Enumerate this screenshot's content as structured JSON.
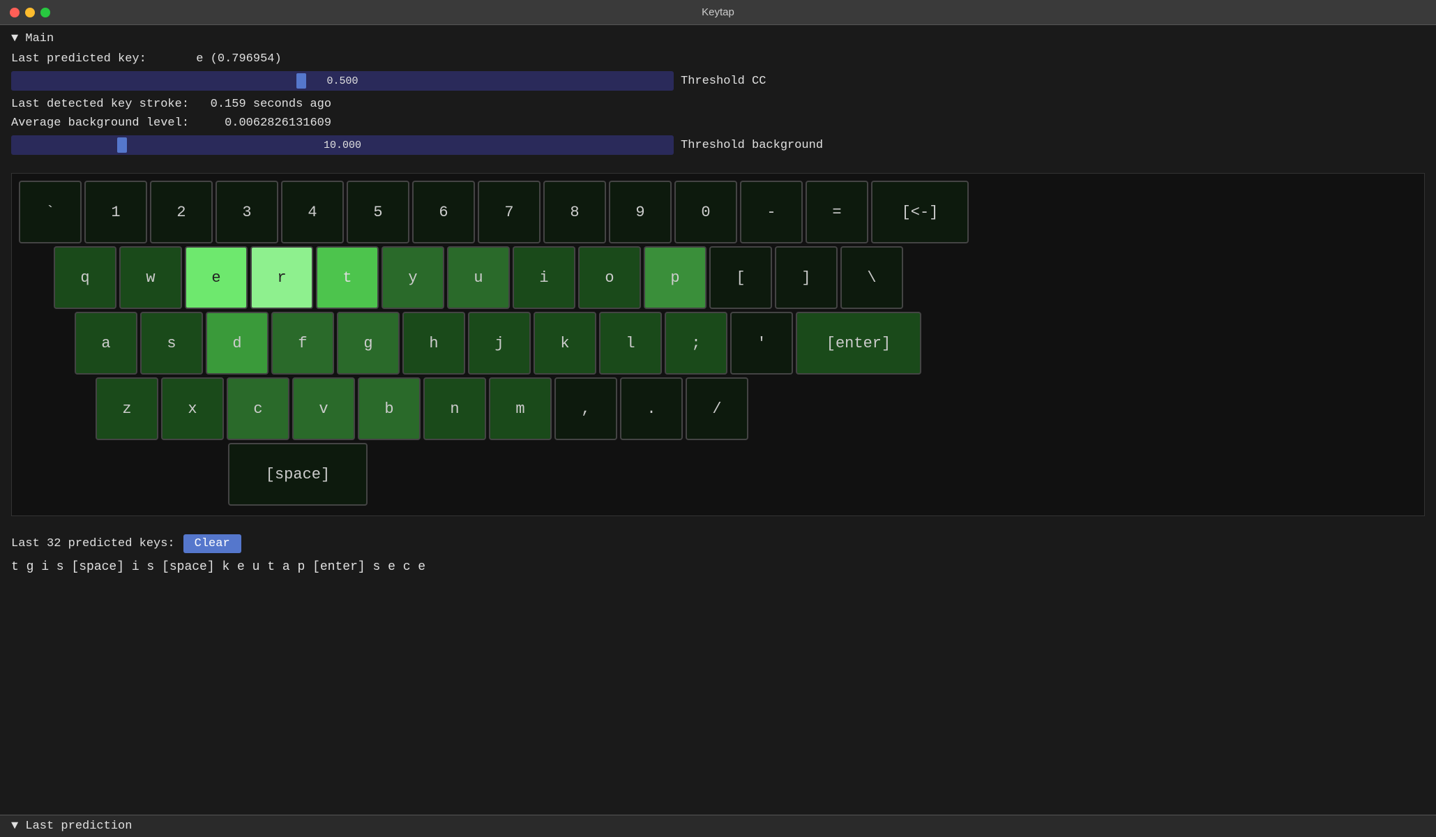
{
  "titleBar": {
    "title": "Keytap",
    "buttons": [
      "close",
      "minimize",
      "maximize"
    ]
  },
  "mainSection": {
    "header": "▼ Main",
    "lastPredictedKey": {
      "label": "Last predicted key:",
      "value": "e (0.796954)"
    },
    "thresholdCC": {
      "sliderValue": "0.500",
      "label": "Threshold CC",
      "thumbPercent": 43
    },
    "lastDetectedStroke": {
      "label": "Last detected key stroke:",
      "value": "0.159 seconds ago"
    },
    "avgBackgroundLevel": {
      "label": "Average background level:",
      "value": "0.0062826131609"
    },
    "thresholdBackground": {
      "sliderValue": "10.000",
      "label": "Threshold background",
      "thumbPercent": 16
    }
  },
  "keyboard": {
    "rows": [
      {
        "id": "row1",
        "indent": 0,
        "keys": [
          {
            "label": "`",
            "style": "dark"
          },
          {
            "label": "1",
            "style": "dark"
          },
          {
            "label": "2",
            "style": "dark"
          },
          {
            "label": "3",
            "style": "dark"
          },
          {
            "label": "4",
            "style": "dark"
          },
          {
            "label": "5",
            "style": "dark"
          },
          {
            "label": "6",
            "style": "dark"
          },
          {
            "label": "7",
            "style": "dark"
          },
          {
            "label": "8",
            "style": "dark"
          },
          {
            "label": "9",
            "style": "dark"
          },
          {
            "label": "0",
            "style": "dark"
          },
          {
            "label": "-",
            "style": "dark"
          },
          {
            "label": "=",
            "style": "dark"
          },
          {
            "label": "[<-]",
            "style": "dark",
            "wide": true
          }
        ]
      },
      {
        "id": "row2",
        "indent": 50,
        "keys": [
          {
            "label": "q",
            "style": "green1"
          },
          {
            "label": "w",
            "style": "green1"
          },
          {
            "label": "e",
            "style": "green-bright"
          },
          {
            "label": "r",
            "style": "green-light"
          },
          {
            "label": "t",
            "style": "green3"
          },
          {
            "label": "y",
            "style": "green2"
          },
          {
            "label": "u",
            "style": "green2"
          },
          {
            "label": "i",
            "style": "green1"
          },
          {
            "label": "o",
            "style": "green1"
          },
          {
            "label": "p",
            "style": "green3"
          },
          {
            "label": "[",
            "style": "dark"
          },
          {
            "label": "]",
            "style": "dark"
          },
          {
            "label": "\\",
            "style": "dark"
          }
        ]
      },
      {
        "id": "row3",
        "indent": 80,
        "keys": [
          {
            "label": "a",
            "style": "green1"
          },
          {
            "label": "s",
            "style": "green1"
          },
          {
            "label": "d",
            "style": "green3"
          },
          {
            "label": "f",
            "style": "green2"
          },
          {
            "label": "g",
            "style": "green2"
          },
          {
            "label": "h",
            "style": "green1"
          },
          {
            "label": "j",
            "style": "green1"
          },
          {
            "label": "k",
            "style": "green1"
          },
          {
            "label": "l",
            "style": "green1"
          },
          {
            "label": ";",
            "style": "green1"
          },
          {
            "label": "'",
            "style": "dark"
          },
          {
            "label": "[enter]",
            "style": "green1",
            "wide": true
          }
        ]
      },
      {
        "id": "row4",
        "indent": 110,
        "keys": [
          {
            "label": "z",
            "style": "green1"
          },
          {
            "label": "x",
            "style": "green1"
          },
          {
            "label": "c",
            "style": "green2"
          },
          {
            "label": "v",
            "style": "green2"
          },
          {
            "label": "b",
            "style": "green2"
          },
          {
            "label": "n",
            "style": "green1"
          },
          {
            "label": "m",
            "style": "green1"
          },
          {
            "label": ",",
            "style": "dark"
          },
          {
            "label": ".",
            "style": "dark"
          },
          {
            "label": "/",
            "style": "dark"
          }
        ]
      },
      {
        "id": "row5",
        "indent": 300,
        "keys": [
          {
            "label": "[space]",
            "style": "dark",
            "space": true
          }
        ]
      }
    ]
  },
  "predictedKeys": {
    "label": "Last 32 predicted keys:",
    "clearButton": "Clear",
    "predictedText": "t g i s [space] i s [space] k e u t a p [enter] s e c e"
  },
  "lastPrediction": {
    "header": "▼ Last prediction"
  }
}
